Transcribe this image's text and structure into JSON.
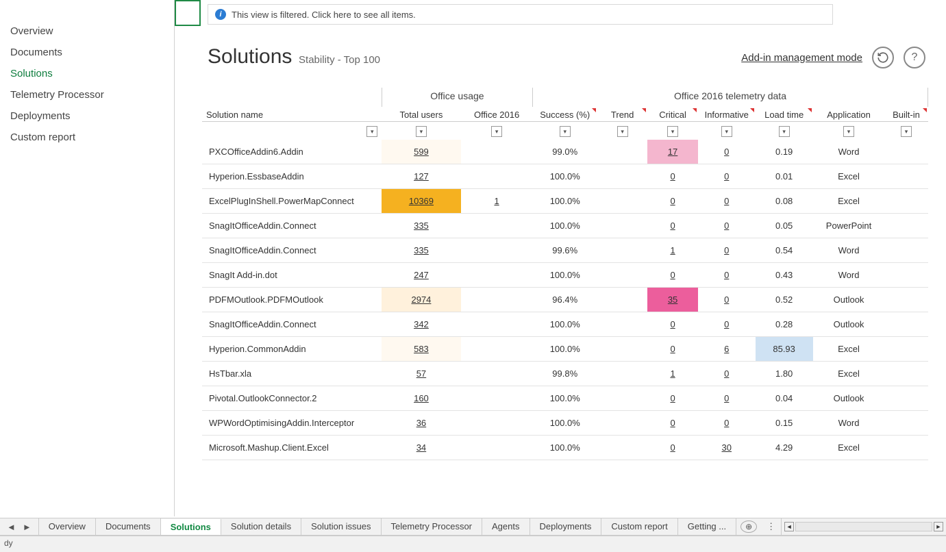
{
  "sidebar": {
    "items": [
      {
        "label": "Overview",
        "active": false
      },
      {
        "label": "Documents",
        "active": false
      },
      {
        "label": "Solutions",
        "active": true
      },
      {
        "label": "Telemetry Processor",
        "active": false
      },
      {
        "label": "Deployments",
        "active": false
      },
      {
        "label": "Custom report",
        "active": false
      }
    ]
  },
  "filter_banner": "This view is filtered. Click here to see all items.",
  "header": {
    "title": "Solutions",
    "subtitle": "Stability - Top 100",
    "mode_link": "Add-in management mode"
  },
  "group_headers": {
    "usage": "Office usage",
    "telemetry": "Office 2016 telemetry data"
  },
  "columns": {
    "name": "Solution name",
    "total": "Total users",
    "o2016": "Office 2016",
    "success": "Success (%)",
    "trend": "Trend",
    "critical": "Critical",
    "informative": "Informative",
    "load": "Load time",
    "app": "Application",
    "builtin": "Built-in"
  },
  "rows": [
    {
      "name": "PXCOfficeAddin6.Addin",
      "total": "599",
      "total_hl": "hl-lightest",
      "o2016": "",
      "success": "99.0%",
      "critical": "17",
      "critical_hl": "hl-pink",
      "informative": "0",
      "load": "0.19",
      "app": "Word"
    },
    {
      "name": "Hyperion.EssbaseAddin",
      "total": "127",
      "o2016": "",
      "success": "100.0%",
      "critical": "0",
      "informative": "0",
      "load": "0.01",
      "app": "Excel"
    },
    {
      "name": "ExcelPlugInShell.PowerMapConnect",
      "total": "10369",
      "total_hl": "hl-orange",
      "o2016": "1",
      "success": "100.0%",
      "critical": "0",
      "informative": "0",
      "load": "0.08",
      "app": "Excel"
    },
    {
      "name": "SnagItOfficeAddin.Connect",
      "total": "335",
      "o2016": "",
      "success": "100.0%",
      "critical": "0",
      "informative": "0",
      "load": "0.05",
      "app": "PowerPoint"
    },
    {
      "name": "SnagItOfficeAddin.Connect",
      "total": "335",
      "o2016": "",
      "success": "99.6%",
      "critical": "1",
      "informative": "0",
      "load": "0.54",
      "app": "Word"
    },
    {
      "name": "SnagIt Add-in.dot",
      "total": "247",
      "o2016": "",
      "success": "100.0%",
      "critical": "0",
      "informative": "0",
      "load": "0.43",
      "app": "Word"
    },
    {
      "name": "PDFMOutlook.PDFMOutlook",
      "total": "2974",
      "total_hl": "hl-light",
      "o2016": "",
      "success": "96.4%",
      "critical": "35",
      "critical_hl": "hl-hotpink",
      "informative": "0",
      "load": "0.52",
      "app": "Outlook"
    },
    {
      "name": "SnagItOfficeAddin.Connect",
      "total": "342",
      "o2016": "",
      "success": "100.0%",
      "critical": "0",
      "informative": "0",
      "load": "0.28",
      "app": "Outlook"
    },
    {
      "name": "Hyperion.CommonAddin",
      "total": "583",
      "total_hl": "hl-lightest",
      "o2016": "",
      "success": "100.0%",
      "critical": "0",
      "informative": "6",
      "load": "85.93",
      "load_hl": "hl-blue",
      "app": "Excel"
    },
    {
      "name": "HsTbar.xla",
      "total": "57",
      "o2016": "",
      "success": "99.8%",
      "critical": "1",
      "informative": "0",
      "load": "1.80",
      "app": "Excel"
    },
    {
      "name": "Pivotal.OutlookConnector.2",
      "total": "160",
      "o2016": "",
      "success": "100.0%",
      "critical": "0",
      "informative": "0",
      "load": "0.04",
      "app": "Outlook"
    },
    {
      "name": "WPWordOptimisingAddin.Interceptor",
      "total": "36",
      "o2016": "",
      "success": "100.0%",
      "critical": "0",
      "informative": "0",
      "load": "0.15",
      "app": "Word"
    },
    {
      "name": "Microsoft.Mashup.Client.Excel",
      "total": "34",
      "o2016": "",
      "success": "100.0%",
      "critical": "0",
      "informative": "30",
      "load": "4.29",
      "app": "Excel"
    }
  ],
  "sheet_tabs": [
    {
      "label": "Overview",
      "active": false
    },
    {
      "label": "Documents",
      "active": false
    },
    {
      "label": "Solutions",
      "active": true
    },
    {
      "label": "Solution details",
      "active": false
    },
    {
      "label": "Solution issues",
      "active": false
    },
    {
      "label": "Telemetry Processor",
      "active": false
    },
    {
      "label": "Agents",
      "active": false
    },
    {
      "label": "Deployments",
      "active": false
    },
    {
      "label": "Custom report",
      "active": false
    },
    {
      "label": "Getting ...",
      "active": false
    }
  ],
  "status": "dy"
}
